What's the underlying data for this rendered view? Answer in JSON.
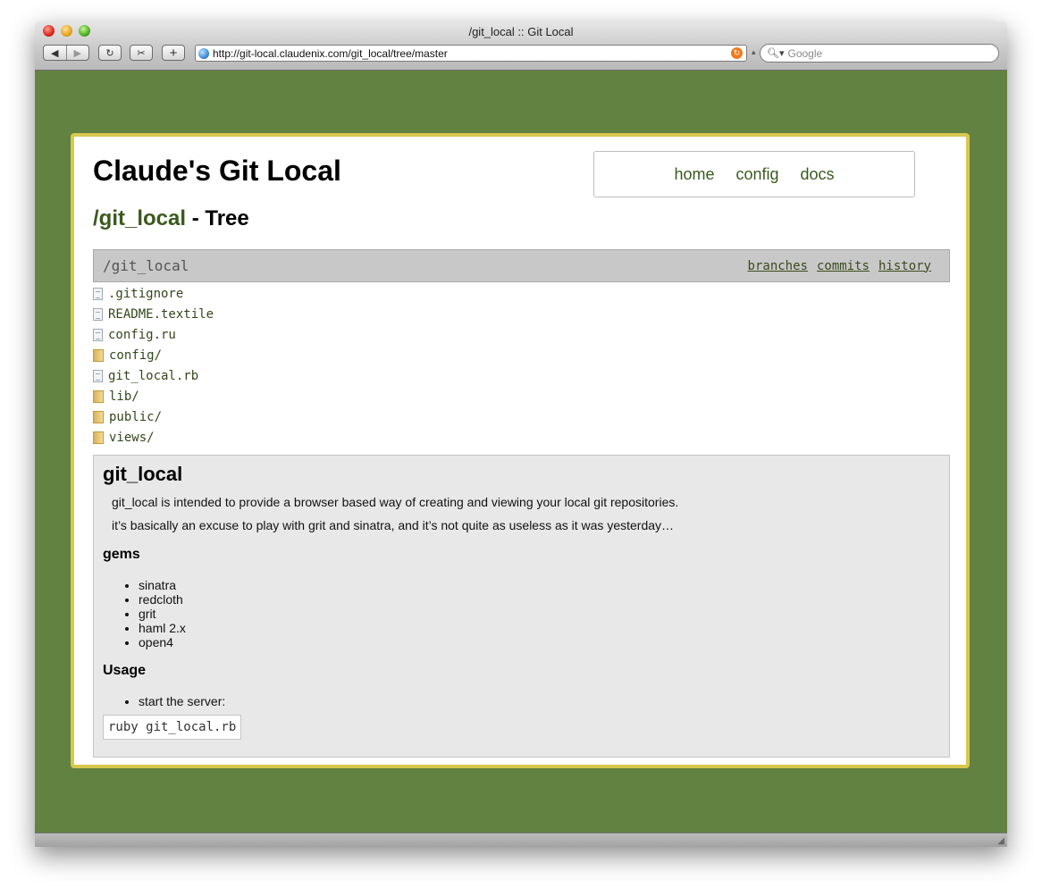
{
  "browser": {
    "window_title": "/git_local :: Git Local",
    "back_icon": "back-arrow-icon",
    "forward_icon": "forward-arrow-icon",
    "url": "http://git-local.claudenix.com/git_local/tree/master",
    "search_placeholder": "Google"
  },
  "site": {
    "title": "Claude's Git Local",
    "nav": [
      {
        "label": "home"
      },
      {
        "label": "config"
      },
      {
        "label": "docs"
      }
    ]
  },
  "page": {
    "repo_link": "/git_local",
    "heading_suffix": " - Tree"
  },
  "tree": {
    "path": "/git_local",
    "links": [
      {
        "label": "branches"
      },
      {
        "label": "commits"
      },
      {
        "label": "history"
      }
    ],
    "files": [
      {
        "name": ".gitignore",
        "type": "file"
      },
      {
        "name": "README.textile",
        "type": "file"
      },
      {
        "name": "config.ru",
        "type": "file"
      },
      {
        "name": "config/",
        "type": "folder"
      },
      {
        "name": "git_local.rb",
        "type": "file"
      },
      {
        "name": "lib/",
        "type": "folder"
      },
      {
        "name": "public/",
        "type": "folder"
      },
      {
        "name": "views/",
        "type": "folder"
      }
    ]
  },
  "readme": {
    "title": "git_local",
    "intro": "git_local is intended to provide a browser based way of creating and viewing your local git repositories.",
    "intro2": "it’s basically an excuse to play with grit and sinatra, and it’s not quite as useless as it was yesterday…",
    "gems_heading": "gems",
    "gems": [
      "sinatra",
      "redcloth",
      "grit",
      "haml 2.x",
      "open4"
    ],
    "usage_heading": "Usage",
    "usage_items": [
      "start the server:"
    ],
    "code": "ruby git_local.rb"
  },
  "colors": {
    "background": "#628242",
    "card_border": "#d8c74f",
    "link": "#3b5a1e"
  }
}
